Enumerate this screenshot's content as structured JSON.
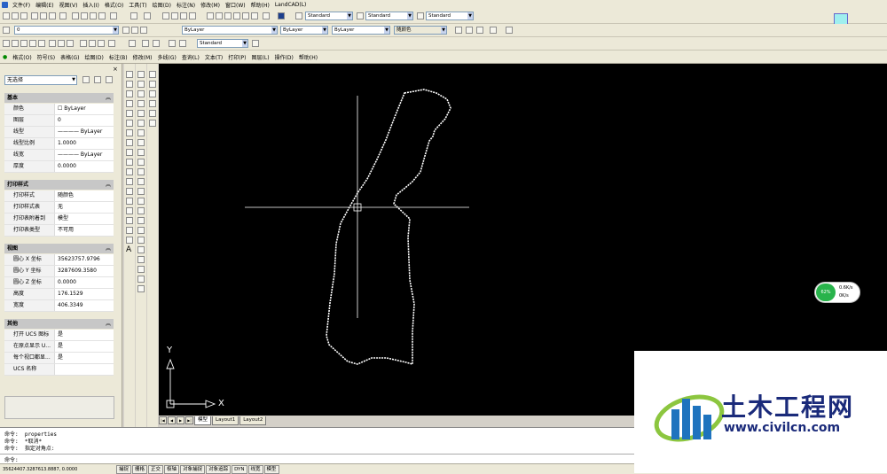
{
  "menubar": {
    "items": [
      "文件(F)",
      "编辑(E)",
      "视图(V)",
      "插入(I)",
      "格式(O)",
      "工具(T)",
      "绘图(D)",
      "标注(N)",
      "修改(M)",
      "窗口(W)",
      "帮助(H)",
      "LandCAD(L)"
    ]
  },
  "toolbars": {
    "style_combos": [
      "Standard",
      "Standard",
      "Standard"
    ],
    "layer_combo": "0",
    "bylayer_color": "ByLayer",
    "bylayer_linetype": "ByLayer",
    "bylayer_lineweight": "ByLayer",
    "plot_style": "随颜色",
    "dim_style": "Standard"
  },
  "menu2": {
    "items": [
      "格式(O)",
      "符号(S)",
      "表格(G)",
      "绘图(D)",
      "标注(B)",
      "修改(M)",
      "多线(G)",
      "查询(L)",
      "文本(T)",
      "打印(P)",
      "图层(L)",
      "操作(D)",
      "帮助(H)"
    ]
  },
  "properties": {
    "selection": "无选择",
    "sections": [
      {
        "title": "基本",
        "rows": [
          {
            "k": "颜色",
            "v": "☐ ByLayer"
          },
          {
            "k": "图层",
            "v": "0"
          },
          {
            "k": "线型",
            "v": "———— ByLayer"
          },
          {
            "k": "线型比例",
            "v": "1.0000"
          },
          {
            "k": "线宽",
            "v": "———— ByLayer"
          },
          {
            "k": "厚度",
            "v": "0.0000"
          }
        ]
      },
      {
        "title": "打印样式",
        "rows": [
          {
            "k": "打印样式",
            "v": "随颜色"
          },
          {
            "k": "打印样式表",
            "v": "无"
          },
          {
            "k": "打印表附着到",
            "v": "模型"
          },
          {
            "k": "打印表类型",
            "v": "不可用"
          }
        ]
      },
      {
        "title": "视图",
        "rows": [
          {
            "k": "圆心 X 坐标",
            "v": "35623757.9796"
          },
          {
            "k": "圆心 Y 坐标",
            "v": "3287609.3580"
          },
          {
            "k": "圆心 Z 坐标",
            "v": "0.0000"
          },
          {
            "k": "高度",
            "v": "176.1529"
          },
          {
            "k": "宽度",
            "v": "406.3349"
          }
        ]
      },
      {
        "title": "其他",
        "rows": [
          {
            "k": "打开 UCS 图标",
            "v": "是"
          },
          {
            "k": "在原点显示 U...",
            "v": "是"
          },
          {
            "k": "每个视口都显...",
            "v": "是"
          },
          {
            "k": "UCS 名称",
            "v": ""
          }
        ]
      }
    ]
  },
  "canvas": {
    "ucs_x": "X",
    "ucs_y": "Y"
  },
  "tabs": [
    "模型",
    "Layout1",
    "Layout2"
  ],
  "command_lines": [
    "命令:  properties",
    "命令:  *取消*",
    "命令:  指定对角点:",
    "命令:"
  ],
  "status": {
    "coords": "35624407.3287613.8887, 0.0000",
    "buttons": [
      "捕捉",
      "栅格",
      "正交",
      "极轴",
      "对象捕捉",
      "对象追踪",
      "DYN",
      "线宽",
      "模型"
    ]
  },
  "network_widget": {
    "percent": "62%",
    "up": "0.6K/s",
    "down": "0K/s"
  },
  "watermark": {
    "title": "土木工程网",
    "url": "www.civilcn.com"
  }
}
